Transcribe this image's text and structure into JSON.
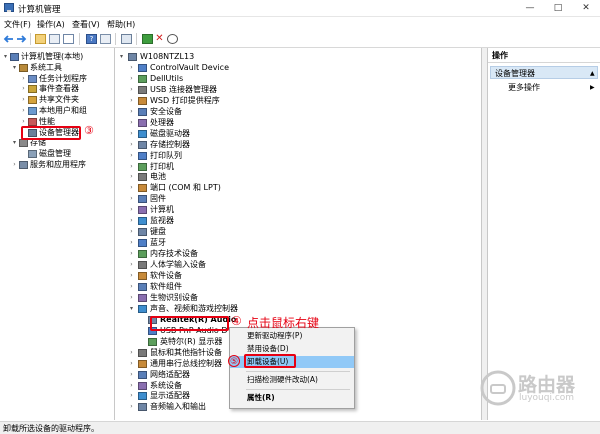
{
  "window": {
    "title": "计算机管理"
  },
  "menubar": [
    "文件(F)",
    "操作(A)",
    "查看(V)",
    "帮助(H)"
  ],
  "left_tree": [
    {
      "label": "计算机管理(本地)",
      "level": 0,
      "arrow": "down",
      "icon": "computer-management-icon"
    },
    {
      "label": "系统工具",
      "level": 1,
      "arrow": "down",
      "icon": "system-tools-icon"
    },
    {
      "label": "任务计划程序",
      "level": 2,
      "arrow": "right",
      "icon": "clock-icon"
    },
    {
      "label": "事件查看器",
      "level": 2,
      "arrow": "right",
      "icon": "event-viewer-icon"
    },
    {
      "label": "共享文件夹",
      "level": 2,
      "arrow": "right",
      "icon": "shared-folder-icon"
    },
    {
      "label": "本地用户和组",
      "level": 2,
      "arrow": "right",
      "icon": "users-icon"
    },
    {
      "label": "性能",
      "level": 2,
      "arrow": "right",
      "icon": "performance-icon"
    },
    {
      "label": "设备管理器",
      "level": 2,
      "arrow": "",
      "icon": "device-manager-icon"
    },
    {
      "label": "存储",
      "level": 1,
      "arrow": "down",
      "icon": "storage-icon"
    },
    {
      "label": "磁盘管理",
      "level": 2,
      "arrow": "",
      "icon": "disk-icon"
    },
    {
      "label": "服务和应用程序",
      "level": 1,
      "arrow": "right",
      "icon": "services-icon"
    }
  ],
  "device_tree": [
    {
      "label": "W108NTZL13",
      "level": 0,
      "arrow": "down"
    },
    {
      "label": "ControlVault Device",
      "level": 1,
      "arrow": "right"
    },
    {
      "label": "DellUtils",
      "level": 1,
      "arrow": "right"
    },
    {
      "label": "USB 连接器管理器",
      "level": 1,
      "arrow": "right"
    },
    {
      "label": "WSD 打印提供程序",
      "level": 1,
      "arrow": "right"
    },
    {
      "label": "安全设备",
      "level": 1,
      "arrow": "right"
    },
    {
      "label": "处理器",
      "level": 1,
      "arrow": "right"
    },
    {
      "label": "磁盘驱动器",
      "level": 1,
      "arrow": "right"
    },
    {
      "label": "存储控制器",
      "level": 1,
      "arrow": "right"
    },
    {
      "label": "打印队列",
      "level": 1,
      "arrow": "right"
    },
    {
      "label": "打印机",
      "level": 1,
      "arrow": "right"
    },
    {
      "label": "电池",
      "level": 1,
      "arrow": "right"
    },
    {
      "label": "端口 (COM 和 LPT)",
      "level": 1,
      "arrow": "right"
    },
    {
      "label": "固件",
      "level": 1,
      "arrow": "right"
    },
    {
      "label": "计算机",
      "level": 1,
      "arrow": "right"
    },
    {
      "label": "监视器",
      "level": 1,
      "arrow": "right"
    },
    {
      "label": "键盘",
      "level": 1,
      "arrow": "right"
    },
    {
      "label": "蓝牙",
      "level": 1,
      "arrow": "right"
    },
    {
      "label": "内存技术设备",
      "level": 1,
      "arrow": "right"
    },
    {
      "label": "人体学输入设备",
      "level": 1,
      "arrow": "right"
    },
    {
      "label": "软件设备",
      "level": 1,
      "arrow": "right"
    },
    {
      "label": "软件组件",
      "level": 1,
      "arrow": "right"
    },
    {
      "label": "生物识别设备",
      "level": 1,
      "arrow": "right"
    },
    {
      "label": "声音、视频和游戏控制器",
      "level": 1,
      "arrow": "down"
    },
    {
      "label": "Realtek(R) Audio",
      "level": 2,
      "arrow": ""
    },
    {
      "label": "USB PnP Audio D",
      "level": 2,
      "arrow": ""
    },
    {
      "label": "英特尔(R) 显示器",
      "level": 2,
      "arrow": ""
    },
    {
      "label": "鼠标和其他指针设备",
      "level": 1,
      "arrow": "right"
    },
    {
      "label": "通用串行总线控制器",
      "level": 1,
      "arrow": "right"
    },
    {
      "label": "网络适配器",
      "level": 1,
      "arrow": "right"
    },
    {
      "label": "系统设备",
      "level": 1,
      "arrow": "right"
    },
    {
      "label": "显示适配器",
      "level": 1,
      "arrow": "right"
    },
    {
      "label": "音频输入和输出",
      "level": 1,
      "arrow": "right"
    }
  ],
  "context_menu": {
    "items": [
      "更新驱动程序(P)",
      "禁用设备(D)",
      "卸载设备(U)",
      "扫描检测硬件改动(A)",
      "属性(R)"
    ]
  },
  "annotations": {
    "step3": "③",
    "step4": "④",
    "step4_text": "点击鼠标右键",
    "step5": "⑤"
  },
  "actions": {
    "header": "操作",
    "selected": "设备管理器",
    "more": "更多操作"
  },
  "statusbar": {
    "text": "卸载所选设备的驱动程序。"
  },
  "watermark": {
    "brand": "路由器",
    "url": "luyouqi.com"
  },
  "colors": {
    "annotation_red": "#e60012",
    "selection_blue": "#cce8ff",
    "accent": "#0078d7"
  }
}
